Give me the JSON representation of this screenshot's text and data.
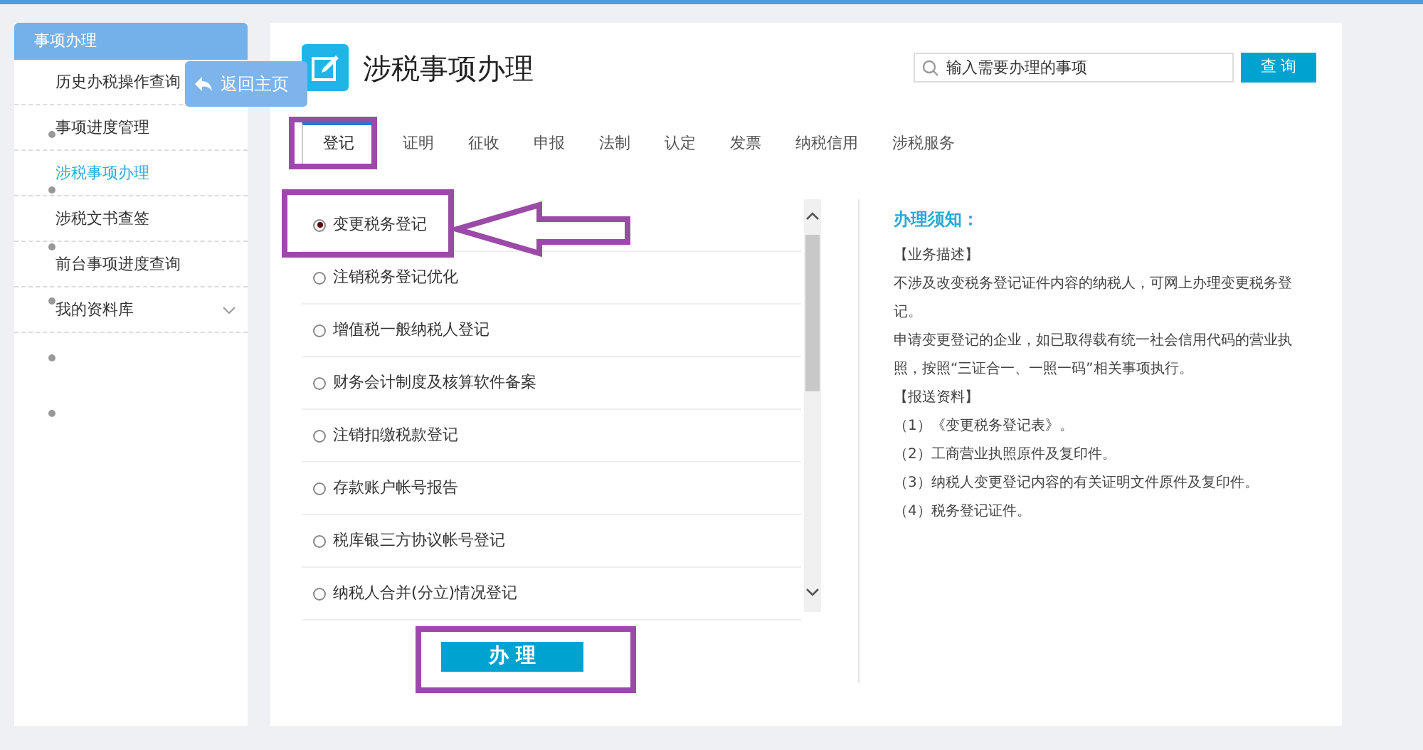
{
  "sidebar": {
    "header": "事项办理",
    "items": [
      {
        "label": "历史办税操作查询",
        "selected": false,
        "kind": "link"
      },
      {
        "label": "事项进度管理",
        "selected": false,
        "kind": "link"
      },
      {
        "label": "涉税事项办理",
        "selected": true,
        "kind": "link"
      },
      {
        "label": "涉税文书查签",
        "selected": false,
        "kind": "link"
      },
      {
        "label": "前台事项进度查询",
        "selected": false,
        "kind": "link"
      },
      {
        "label": "我的资料库",
        "selected": false,
        "kind": "folder"
      }
    ]
  },
  "back_button": {
    "label": "返回主页"
  },
  "title": "涉税事项办理",
  "search": {
    "placeholder": "输入需要办理的事项",
    "button": "查 询"
  },
  "tabs": [
    {
      "label": "登记",
      "selected": true
    },
    {
      "label": "证明",
      "selected": false
    },
    {
      "label": "征收",
      "selected": false
    },
    {
      "label": "申报",
      "selected": false
    },
    {
      "label": "法制",
      "selected": false
    },
    {
      "label": "认定",
      "selected": false
    },
    {
      "label": "发票",
      "selected": false
    },
    {
      "label": "纳税信用",
      "selected": false
    },
    {
      "label": "涉税服务",
      "selected": false
    }
  ],
  "items": [
    {
      "label": "变更税务登记",
      "selected": true
    },
    {
      "label": "注销税务登记优化",
      "selected": false
    },
    {
      "label": "增值税一般纳税人登记",
      "selected": false
    },
    {
      "label": "财务会计制度及核算软件备案",
      "selected": false
    },
    {
      "label": "注销扣缴税款登记",
      "selected": false
    },
    {
      "label": "存款账户帐号报告",
      "selected": false
    },
    {
      "label": "税库银三方协议帐号登记",
      "selected": false
    },
    {
      "label": "纳税人合并(分立)情况登记",
      "selected": false
    }
  ],
  "submit_button": "办 理",
  "notice": {
    "title": "办理须知：",
    "lines": [
      "【业务描述】",
      "不涉及改变税务登记证件内容的纳税人，可网上办理变更税务登记。",
      "申请变更登记的企业，如已取得载有统一社会信用代码的营业执照，按照“三证合一、一照一码”相关事项执行。",
      "【报送资料】",
      "（1）《变更税务登记表》。",
      "（2）工商营业执照原件及复印件。",
      "（3）纳税人变更登记内容的有关证明文件原件及复印件。",
      "（4）税务登记证件。"
    ]
  }
}
